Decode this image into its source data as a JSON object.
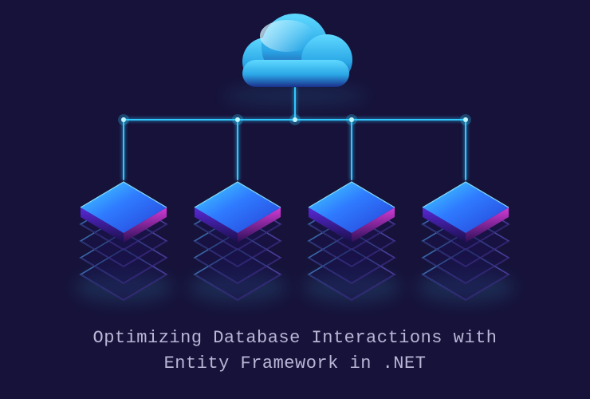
{
  "caption": {
    "text": "Optimizing Database Interactions with\nEntity Framework in .NET"
  },
  "illustration": {
    "semantic": "cloud-connected-to-four-database-stacks",
    "cloud_color": "#2fb7e9",
    "stack_top_color": "#2f6bff",
    "stack_side_color": "#7a2de8",
    "glow_color": "#34d4ff",
    "stacks": 4
  },
  "colors": {
    "background": "#16123a",
    "caption": "#b9b6d6"
  }
}
